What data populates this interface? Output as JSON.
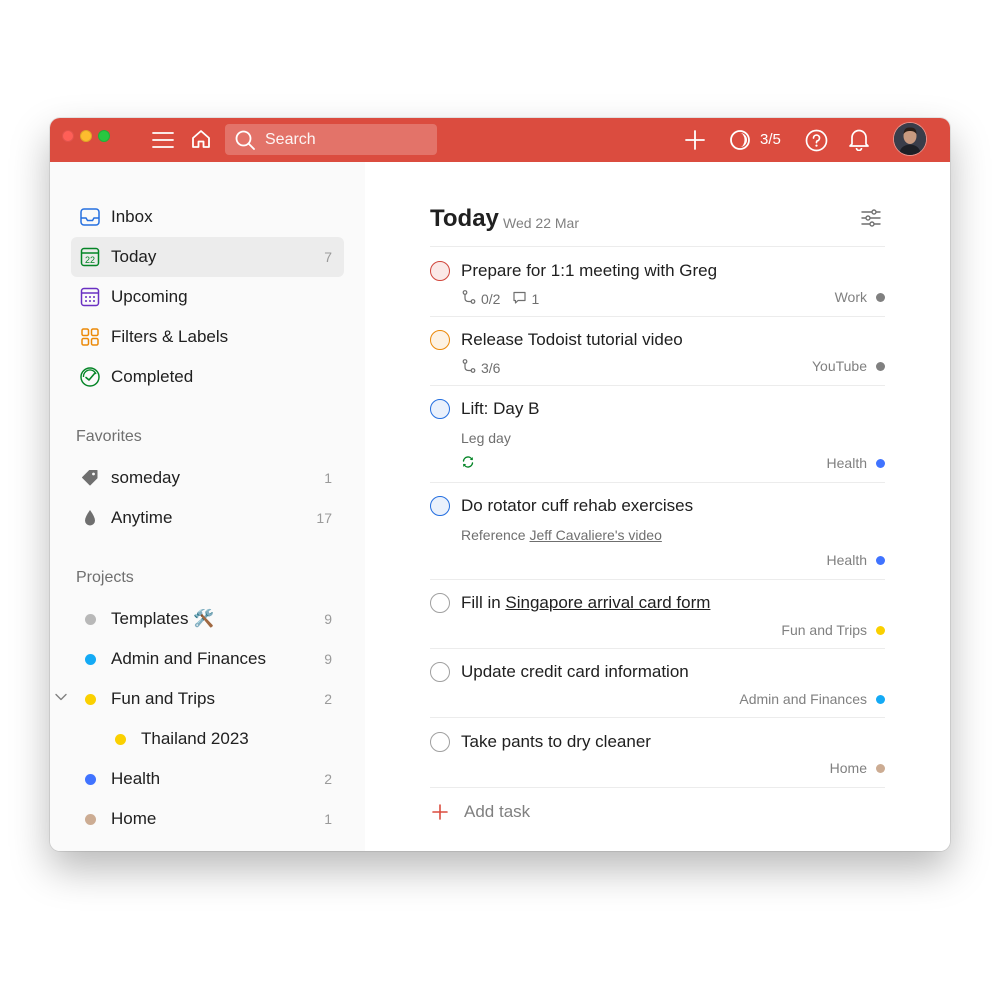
{
  "colors": {
    "brand": "#db4c3f",
    "priority1": "#d1453b",
    "priority2": "#eb8909",
    "priority3": "#246fe0",
    "recurring": "#058527"
  },
  "header": {
    "search_placeholder": "Search",
    "karma_progress": "3/5",
    "icons": [
      "menu-icon",
      "home-icon",
      "search-icon",
      "add-icon",
      "productivity-icon",
      "help-icon",
      "bell-icon"
    ]
  },
  "sidebar": {
    "nav": [
      {
        "label": "Inbox",
        "icon": "inbox-icon",
        "count": ""
      },
      {
        "label": "Today",
        "icon": "calendar-today-icon",
        "count": "7",
        "day": "22"
      },
      {
        "label": "Upcoming",
        "icon": "calendar-grid-icon",
        "count": ""
      },
      {
        "label": "Filters & Labels",
        "icon": "grid-icon",
        "count": ""
      },
      {
        "label": "Completed",
        "icon": "completed-icon",
        "count": ""
      }
    ],
    "favorites_heading": "Favorites",
    "favorites": [
      {
        "label": "someday",
        "icon": "tag-icon",
        "count": "1"
      },
      {
        "label": "Anytime",
        "icon": "drop-icon",
        "count": "17"
      }
    ],
    "projects_heading": "Projects",
    "projects": [
      {
        "label": "Templates 🛠️",
        "color": "#b8b8b8",
        "count": "9"
      },
      {
        "label": "Admin and Finances",
        "color": "#14aaf5",
        "count": "9"
      },
      {
        "label": "Fun and Trips",
        "color": "#fad000",
        "count": "2"
      },
      {
        "label": "Thailand 2023",
        "color": "#fad000",
        "count": ""
      },
      {
        "label": "Health",
        "color": "#4073ff",
        "count": "2"
      },
      {
        "label": "Home",
        "color": "#ccac93",
        "count": "1"
      }
    ]
  },
  "main": {
    "title": "Today",
    "date": "Wed 22 Mar",
    "tasks": [
      {
        "pre": "Prepare for 1:1 meeting with Greg",
        "link": "",
        "subtasks": "0/2",
        "comments": "1",
        "project": "Work",
        "project_color": "#808080"
      },
      {
        "pre": "Release Todoist tutorial video",
        "link": "",
        "subtasks": "3/6",
        "project": "YouTube",
        "project_color": "#808080"
      },
      {
        "pre": "Lift: Day B",
        "link": "",
        "desc": "Leg day",
        "project": "Health",
        "project_color": "#4073ff"
      },
      {
        "pre": "Do rotator cuff rehab exercises",
        "link": "",
        "desc_pre": "Reference ",
        "desc_link": "Jeff Cavaliere's video",
        "project": "Health",
        "project_color": "#4073ff"
      },
      {
        "pre": "Fill in ",
        "link": "Singapore arrival card form",
        "project": "Fun and Trips",
        "project_color": "#fad000"
      },
      {
        "pre": "Update credit card information",
        "link": "",
        "project": "Admin and Finances",
        "project_color": "#14aaf5"
      },
      {
        "pre": "Take pants to dry cleaner",
        "link": "",
        "project": "Home",
        "project_color": "#ccac93"
      }
    ],
    "add_task_label": "Add task"
  }
}
